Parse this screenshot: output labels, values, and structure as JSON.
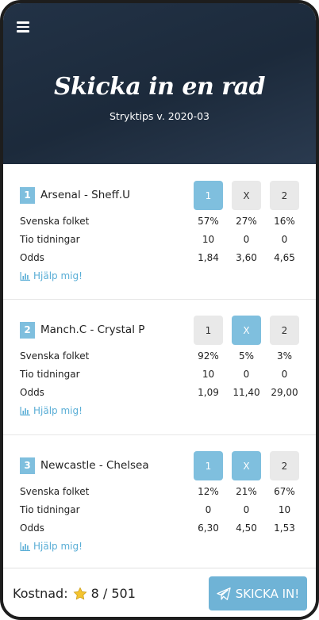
{
  "header": {
    "title": "Skicka in en rad",
    "subtitle": "Stryktips v. 2020-03"
  },
  "labels": {
    "svenska_folket": "Svenska folket",
    "tio_tidningar": "Tio tidningar",
    "odds": "Odds",
    "help": "Hjälp mig!"
  },
  "matches": [
    {
      "number": "1",
      "title": "Arsenal - Sheff.U",
      "options": [
        "1",
        "X",
        "2"
      ],
      "selected": [
        "1"
      ],
      "svenska_folket": [
        "57%",
        "27%",
        "16%"
      ],
      "tio_tidningar": [
        "10",
        "0",
        "0"
      ],
      "odds": [
        "1,84",
        "3,60",
        "4,65"
      ]
    },
    {
      "number": "2",
      "title": "Manch.C - Crystal P",
      "options": [
        "1",
        "X",
        "2"
      ],
      "selected": [
        "X"
      ],
      "svenska_folket": [
        "92%",
        "5%",
        "3%"
      ],
      "tio_tidningar": [
        "10",
        "0",
        "0"
      ],
      "odds": [
        "1,09",
        "11,40",
        "29,00"
      ]
    },
    {
      "number": "3",
      "title": "Newcastle - Chelsea",
      "options": [
        "1",
        "X",
        "2"
      ],
      "selected": [
        "1",
        "X"
      ],
      "svenska_folket": [
        "12%",
        "21%",
        "67%"
      ],
      "tio_tidningar": [
        "0",
        "0",
        "10"
      ],
      "odds": [
        "6,30",
        "4,50",
        "1,53"
      ]
    }
  ],
  "footer": {
    "cost_label": "Kostnad:",
    "cost_value": "8 / 501",
    "star_icon": "star-icon",
    "send_label": "SKICKA IN!",
    "send_icon": "paper-plane-icon"
  },
  "colors": {
    "accent": "#7fbfde",
    "header_bg": "#223246",
    "option_bg": "#e9e9e9",
    "link": "#5aaed6"
  }
}
